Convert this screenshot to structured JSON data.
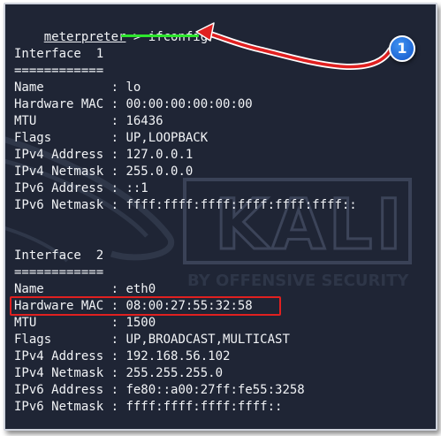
{
  "terminal": {
    "prompt": "meterpreter",
    "separator": " > ",
    "command": "ifconfig"
  },
  "interfaces": [
    {
      "header": "Interface  1",
      "fields": [
        {
          "key": "Name         ",
          "value": "lo"
        },
        {
          "key": "Hardware MAC ",
          "value": "00:00:00:00:00:00"
        },
        {
          "key": "MTU          ",
          "value": "16436"
        },
        {
          "key": "Flags        ",
          "value": "UP,LOOPBACK"
        },
        {
          "key": "IPv4 Address ",
          "value": "127.0.0.1"
        },
        {
          "key": "IPv4 Netmask ",
          "value": "255.0.0.0"
        },
        {
          "key": "IPv6 Address ",
          "value": "::1"
        },
        {
          "key": "IPv6 Netmask ",
          "value": "ffff:ffff:ffff:ffff:ffff:ffff::"
        }
      ]
    },
    {
      "header": "Interface  2",
      "fields": [
        {
          "key": "Name         ",
          "value": "eth0"
        },
        {
          "key": "Hardware MAC ",
          "value": "08:00:27:55:32:58"
        },
        {
          "key": "MTU          ",
          "value": "1500"
        },
        {
          "key": "Flags        ",
          "value": "UP,BROADCAST,MULTICAST"
        },
        {
          "key": "IPv4 Address ",
          "value": "192.168.56.102"
        },
        {
          "key": "IPv4 Netmask ",
          "value": "255.255.255.0"
        },
        {
          "key": "IPv6 Address ",
          "value": "fe80::a00:27ff:fe55:3258"
        },
        {
          "key": "IPv6 Netmask ",
          "value": "ffff:ffff:ffff:ffff::"
        }
      ]
    }
  ],
  "kv_separator": ": ",
  "header_underline": "============",
  "watermark": {
    "logo": "KALI",
    "tagline": "BY OFFENSIVE SECURITY"
  },
  "annotation": {
    "badge_number": "1",
    "badge_color": "#1f6fe0",
    "arrow_color": "#e02020",
    "highlight_color": "#e02020",
    "underline_color": "#2ee62e"
  }
}
